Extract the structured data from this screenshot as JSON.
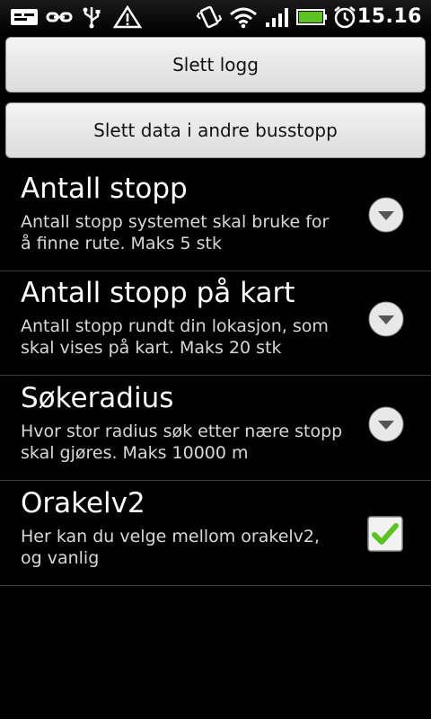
{
  "statusbar": {
    "time": "15.16",
    "icons": [
      "notification-icon",
      "usb-tethering-icon",
      "usb-icon",
      "warning-icon",
      "vibrate-icon",
      "wifi-icon",
      "signal-icon",
      "battery-icon",
      "alarm-icon"
    ]
  },
  "buttons": {
    "clear_log": "Slett logg",
    "clear_other_stops": "Slett data i andre busstopp"
  },
  "preferences": [
    {
      "title": "Antall stopp",
      "summary": "Antall stopp systemet skal bruke for å finne rute. Maks 5 stk",
      "widget": "dropdown"
    },
    {
      "title": "Antall stopp på kart",
      "summary": "Antall stopp rundt din lokasjon, som skal vises på kart. Maks 20 stk",
      "widget": "dropdown"
    },
    {
      "title": "Søkeradius",
      "summary": "Hvor stor radius søk etter nære stopp skal gjøres. Maks 10000 m",
      "widget": "dropdown"
    },
    {
      "title": "Orakelv2",
      "summary": "Her kan du velge mellom orakelv2, og vanlig",
      "widget": "checkbox",
      "checked": true
    }
  ],
  "colors": {
    "accent_check": "#5cc321",
    "background": "#000000"
  }
}
